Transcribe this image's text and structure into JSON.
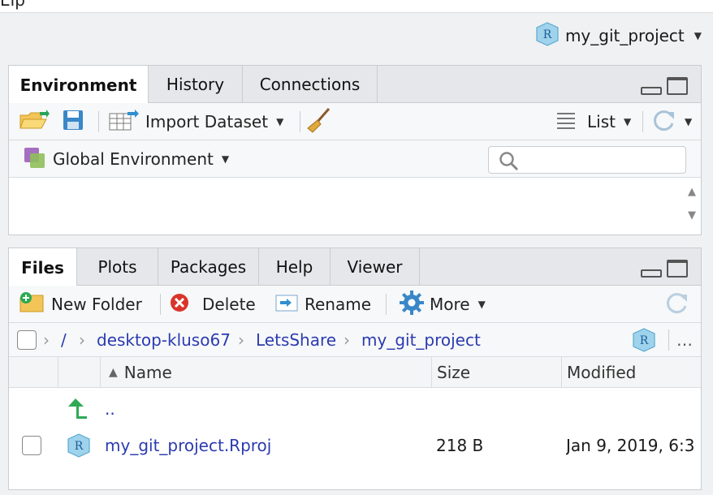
{
  "window": {
    "menu_fragment": "Elp"
  },
  "project": {
    "name": "my_git_project",
    "icon": "r-project-icon"
  },
  "upper_pane": {
    "tabs": [
      {
        "label": "Environment",
        "active": true
      },
      {
        "label": "History",
        "active": false
      },
      {
        "label": "Connections",
        "active": false
      }
    ],
    "toolbar": {
      "import_label": "Import Dataset",
      "view_label": "List"
    },
    "env_selector": "Global Environment",
    "search_placeholder": ""
  },
  "lower_pane": {
    "tabs": [
      {
        "label": "Files",
        "active": true
      },
      {
        "label": "Plots",
        "active": false
      },
      {
        "label": "Packages",
        "active": false
      },
      {
        "label": "Help",
        "active": false
      },
      {
        "label": "Viewer",
        "active": false
      }
    ],
    "toolbar": {
      "new_folder": "New Folder",
      "delete": "Delete",
      "rename": "Rename",
      "more": "More"
    },
    "path": [
      "/",
      "desktop-kluso67",
      "LetsShare",
      "my_git_project"
    ],
    "path_more": "…",
    "columns": {
      "name": "Name",
      "size": "Size",
      "modified": "Modified"
    },
    "rows": [
      {
        "name": "..",
        "size": "",
        "modified": "",
        "type": "parent"
      },
      {
        "name": "my_git_project.Rproj",
        "size": "218 B",
        "modified": "Jan 9, 2019, 6:3",
        "type": "rproj"
      }
    ]
  },
  "colors": {
    "link": "#2b3bb0",
    "tab_bg": "#e5e7ea",
    "border": "#c8cdd2"
  }
}
